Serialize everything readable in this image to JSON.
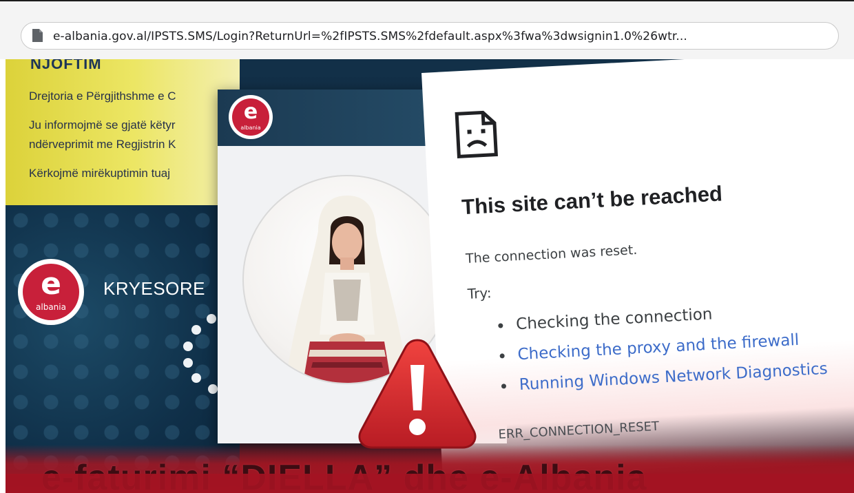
{
  "browser": {
    "url": "e-albania.gov.al/IPSTS.SMS/Login?ReturnUrl=%2fIPSTS.SMS%2fdefault.aspx%3fwa%3dwsignin1.0%26wtr..."
  },
  "notice": {
    "heading": "NJOFTIM",
    "line1": "Drejtoria e Përgjithshme e C",
    "line2": "Ju informojmë se gjatë këtyr",
    "line3": "ndërveprimit me Regjistrin K",
    "line4": "Kërkojmë mirëkuptimin tuaj"
  },
  "portal": {
    "logo_main": "e",
    "logo_sub": "albania",
    "nav_label": "KRYESORE"
  },
  "error_page": {
    "title": "This site can’t be reached",
    "message": "The connection was reset.",
    "try_label": "Try:",
    "suggestions": [
      "Checking the connection",
      "Checking the proxy and the firewall",
      "Running Windows Network Diagnostics"
    ],
    "code": "ERR_CONNECTION_RESET"
  },
  "headline": {
    "text": "e-faturimi “DIELLA” dhe e-Albania"
  },
  "colors": {
    "brand_red": "#c8203a",
    "navy": "#123048",
    "link_blue": "#3d6cc9",
    "warning_red": "#e0262e"
  }
}
